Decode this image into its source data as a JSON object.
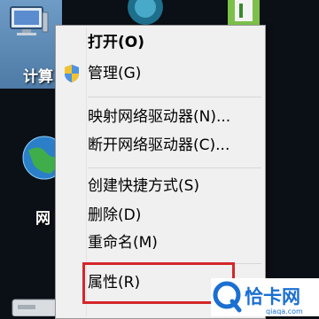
{
  "desktop": {
    "icons": [
      {
        "label": "计算"
      },
      {
        "label": "网"
      }
    ]
  },
  "context_menu": {
    "items": [
      {
        "label": "打开(O)",
        "bold": true
      },
      {
        "label": "管理(G)",
        "icon": "uac-shield-icon"
      },
      {
        "label": "映射网络驱动器(N)..."
      },
      {
        "label": "断开网络驱动器(C)..."
      },
      {
        "label": "创建快捷方式(S)"
      },
      {
        "label": "删除(D)"
      },
      {
        "label": "重命名(M)"
      },
      {
        "label": "属性(R)",
        "highlighted": true
      }
    ]
  },
  "watermark": {
    "brand": "恰卡网",
    "url": "qiaqa.com"
  },
  "colors": {
    "highlight_border": "#d4262a",
    "menu_bg": "#f0f0f0",
    "watermark_blue": "#1b6fd1"
  }
}
